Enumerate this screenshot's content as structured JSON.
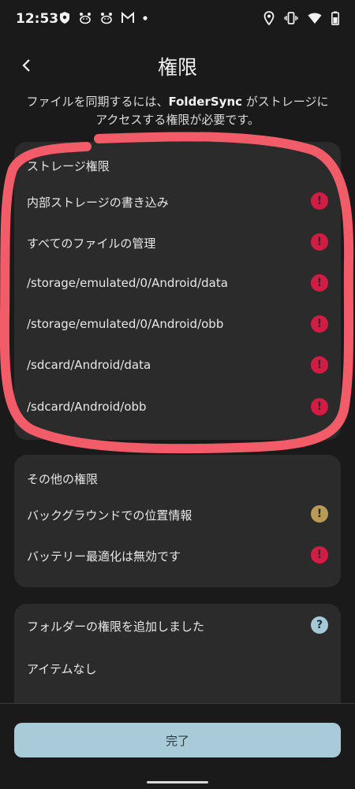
{
  "status_bar": {
    "time": "12:53",
    "left_icons": [
      "shield-icon",
      "paw-icon",
      "paw-icon",
      "gmail-icon",
      "dot-icon"
    ],
    "right_icons": [
      "location-icon",
      "vibrate-icon",
      "wifi-icon",
      "battery-icon"
    ]
  },
  "header": {
    "title": "権限",
    "subtitle_before": "ファイルを同期するには、",
    "subtitle_app": "FolderSync",
    "subtitle_after": " がストレージにアクセスする権限が必要です。"
  },
  "storage": {
    "title": "ストレージ権限",
    "items": [
      {
        "label": "内部ストレージの書き込み",
        "status": "error"
      },
      {
        "label": "すべてのファイルの管理",
        "status": "error"
      },
      {
        "label": "/storage/emulated/0/Android/data",
        "status": "error"
      },
      {
        "label": "/storage/emulated/0/Android/obb",
        "status": "error"
      },
      {
        "label": "/sdcard/Android/data",
        "status": "error"
      },
      {
        "label": "/sdcard/Android/obb",
        "status": "error"
      }
    ]
  },
  "other": {
    "title": "その他の権限",
    "items": [
      {
        "label": "バックグラウンドでの位置情報",
        "status": "warning"
      },
      {
        "label": "バッテリー最適化は無効です",
        "status": "error"
      }
    ]
  },
  "folders": {
    "title": "フォルダーの権限を追加しました",
    "empty": "アイテムなし",
    "status": "help"
  },
  "footer": {
    "done_label": "完了"
  },
  "glyphs": {
    "error": "!",
    "warning": "!",
    "help": "?"
  },
  "colors": {
    "background": "#1a1a1a",
    "card": "#2b2b2b",
    "error": "#d21c44",
    "warning": "#b99a56",
    "help": "#a6c9d8",
    "button": "#a9cbd9",
    "annotation": "#f25b68"
  }
}
